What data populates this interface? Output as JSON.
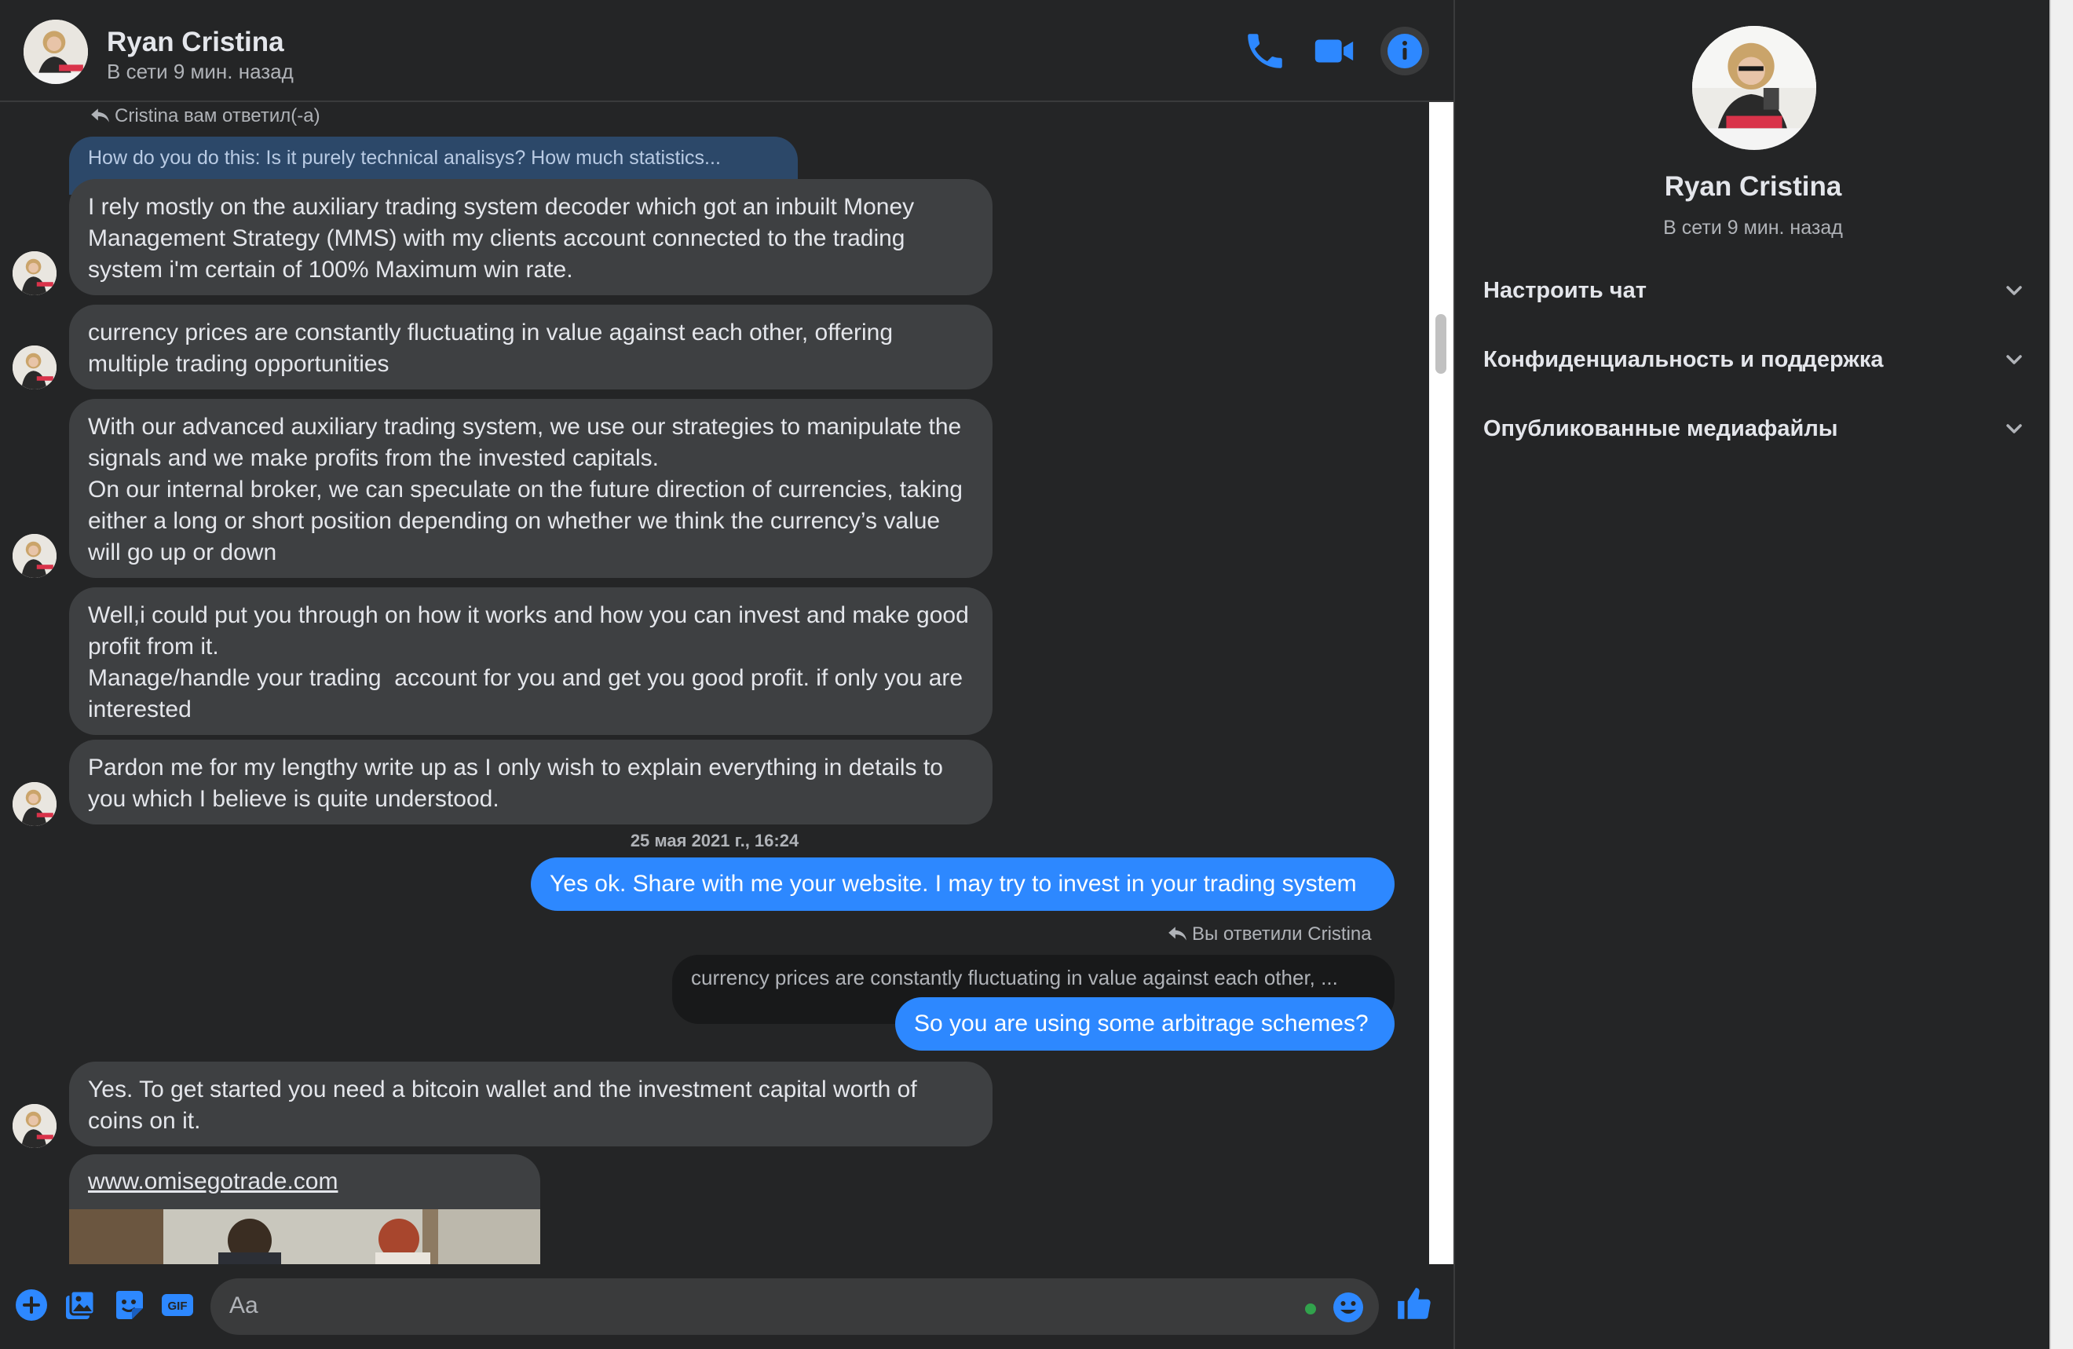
{
  "contact": {
    "name": "Ryan Cristina",
    "status": "В сети 9 мин. назад"
  },
  "header_icons": {
    "phone": "phone-icon",
    "video": "video-camera-icon",
    "info": "info-icon"
  },
  "conversation": {
    "reply_hint_in": "Cristina вам ответил(-а)",
    "quoted_in": "How do you do this: Is it purely technical analisys? How much statistics...",
    "incoming_1": [
      "I rely mostly on the auxiliary trading system decoder which got an inbuilt Money Management Strategy (MMS) with my clients account connected to the trading system i'm certain of 100% Maximum win rate.",
      "currency prices are constantly fluctuating in value against each other, offering multiple trading opportunities",
      "With our advanced auxiliary trading system, we use our strategies to manipulate the signals and we make profits from the invested capitals.\nOn our internal broker, we can speculate on the future direction of currencies, taking either a long or short position depending on whether we think the currency’s value will go up or down",
      "Well,i could put you through on how it works and how you can invest and make good profit from it.\nManage/handle your trading  account for you and get you good profit. if only you are interested",
      "Pardon me for my lengthy write up as I only wish to explain everything in details to you which I believe is quite understood."
    ],
    "timestamp": "25 мая 2021 г., 16:24",
    "outgoing_1": "Yes ok. Share with me your website. I may try to invest in your trading system",
    "reply_hint_out": "Вы ответили Cristina",
    "quoted_out": "currency prices are constantly fluctuating in value against each other, ...",
    "outgoing_2": "So you are using some arbitrage schemes?",
    "incoming_2": "Yes. To get started you need a bitcoin wallet and the investment capital worth of coins on it.",
    "link": "www.omisegotrade.com"
  },
  "composer": {
    "placeholder": "Aa",
    "icons": [
      "plus-icon",
      "photo-icon",
      "sticker-icon",
      "gif-icon",
      "emoji-icon",
      "like-icon"
    ]
  },
  "panel": {
    "name": "Ryan Cristina",
    "status": "В сети 9 мин. назад",
    "sections": [
      "Настроить чат",
      "Конфиденциальность и поддержка",
      "Опубликованные медиафайлы"
    ]
  },
  "colors": {
    "accent": "#2d88ff",
    "background": "#242526",
    "bubble_incoming": "#3e4042",
    "online": "#31a24c"
  }
}
